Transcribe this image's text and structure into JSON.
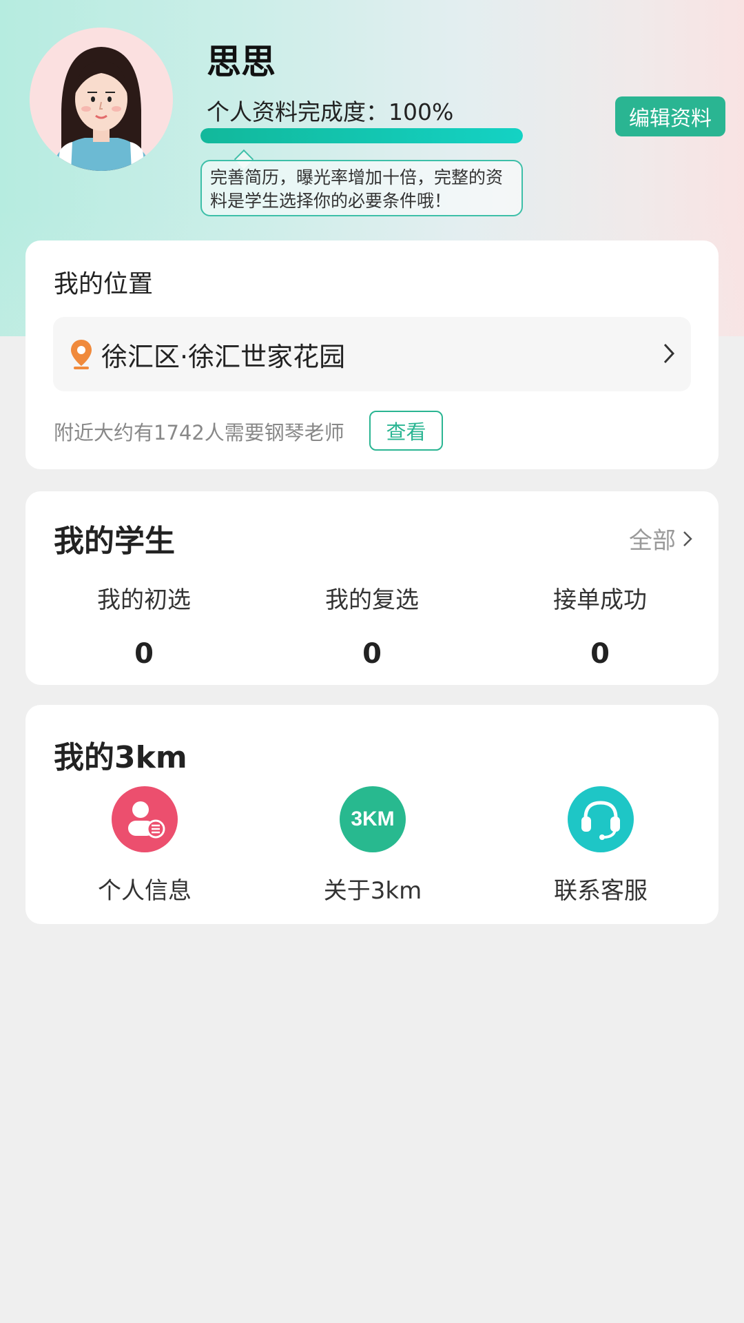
{
  "profile": {
    "name": "思思",
    "completion_label": "个人资料完成度：",
    "completion_value": "100%",
    "completion_fraction": 1.0,
    "tip": "完善简历，曝光率增加十倍，完整的资料是学生选择你的必要条件哦！",
    "edit_label": "编辑资料"
  },
  "location": {
    "title": "我的位置",
    "address": "徐汇区·徐汇世家花园",
    "nearby_text": "附近大约有1742人需要钢琴老师",
    "view_label": "查看"
  },
  "students": {
    "title": "我的学生",
    "all_label": "全部",
    "stats": [
      {
        "label": "我的初选",
        "value": "0"
      },
      {
        "label": "我的复选",
        "value": "0"
      },
      {
        "label": "接单成功",
        "value": "0"
      }
    ]
  },
  "my3km": {
    "title": "我的3km",
    "items": [
      {
        "label": "个人信息",
        "icon": "personal-info-icon",
        "color": "#ec4f6e"
      },
      {
        "label": "关于3km",
        "icon": "3km-logo-icon",
        "color": "#28b98f",
        "icon_text": "3KM"
      },
      {
        "label": "联系客服",
        "icon": "headset-icon",
        "color": "#1ec6c6"
      }
    ]
  },
  "colors": {
    "accent": "#2ab592",
    "pin": "#f08a3c"
  }
}
